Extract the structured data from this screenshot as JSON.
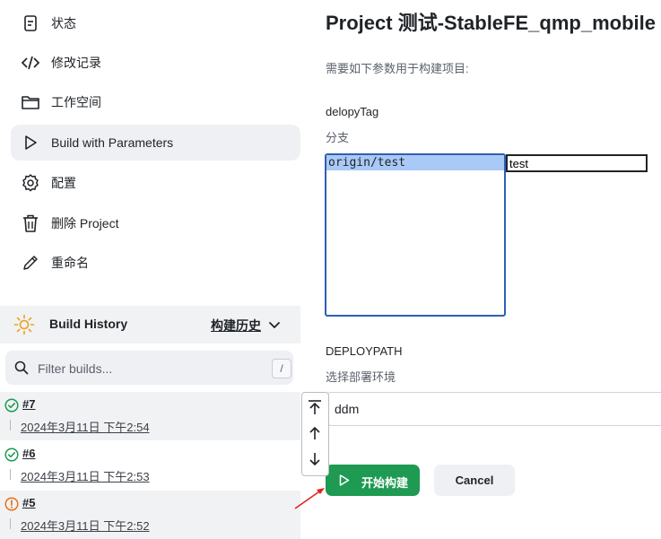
{
  "sidebar": {
    "items": [
      {
        "label": "状态",
        "icon": "document-icon"
      },
      {
        "label": "修改记录",
        "icon": "code-icon"
      },
      {
        "label": "工作空间",
        "icon": "folder-icon"
      },
      {
        "label": "Build with Parameters",
        "icon": "play-icon"
      },
      {
        "label": "配置",
        "icon": "gear-icon"
      },
      {
        "label": "删除 Project",
        "icon": "trash-icon"
      },
      {
        "label": "重命名",
        "icon": "pencil-icon"
      }
    ],
    "active_index": 3
  },
  "build_history": {
    "title": "Build History",
    "trend_label": "构建历史",
    "filter_placeholder": "Filter builds...",
    "filter_shortcut": "/",
    "builds": [
      {
        "number": "#7",
        "date": "2024年3月11日 下午2:54",
        "status": "success"
      },
      {
        "number": "#6",
        "date": "2024年3月11日 下午2:53",
        "status": "success"
      },
      {
        "number": "#5",
        "date": "2024年3月11日 下午2:52",
        "status": "unstable"
      }
    ]
  },
  "main": {
    "title": "Project 测试-StableFE_qmp_mobile",
    "description": "需要如下参数用于构建项目:",
    "params": [
      {
        "name": "delopyTag",
        "description": "分支",
        "options": [
          "origin/test"
        ],
        "selected": "origin/test",
        "input_value": "test"
      },
      {
        "name": "DEPLOYPATH",
        "description": "选择部署环境",
        "value": "ddm"
      }
    ],
    "build_button": "开始构建",
    "cancel_button": "Cancel"
  },
  "colors": {
    "accent": "#1e9a52",
    "select_border": "#2f5fb3",
    "success": "#1e9a52",
    "warning": "#e8711a",
    "annotation_arrow": "#e0241b"
  }
}
